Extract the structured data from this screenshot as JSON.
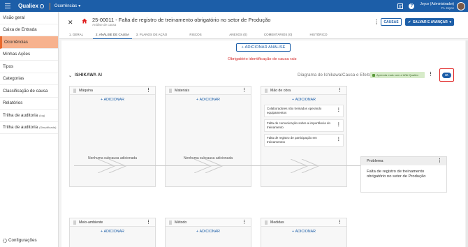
{
  "topbar": {
    "logo": "Qualiex",
    "module": "Ocorrências",
    "user_name": "Joyce (Administrador)",
    "user_sub": "FL Joyce"
  },
  "sidebar": {
    "items": [
      {
        "label": "Visão geral",
        "suffix": ""
      },
      {
        "label": "Caixa de Entrada",
        "suffix": ""
      },
      {
        "label": "Ocorrências",
        "suffix": ""
      },
      {
        "label": "Minhas Ações",
        "suffix": ""
      },
      {
        "label": "Tipos",
        "suffix": ""
      },
      {
        "label": "Categorias",
        "suffix": ""
      },
      {
        "label": "Classificação de causa",
        "suffix": ""
      },
      {
        "label": "Relatórios",
        "suffix": ""
      },
      {
        "label": "Trilha de auditoria",
        "suffix": "(log)"
      },
      {
        "label": "Trilha de auditoria",
        "suffix": "(Simplificada)"
      }
    ],
    "settings": "Configurações"
  },
  "header": {
    "title": "25-00011 - Falta de registro de treinamento obrigatório no setor de Produção",
    "subtitle": "Análise de causa",
    "causas_label": "CAUSAS",
    "save_label": "SALVAR E AVANÇAR",
    "tabs": [
      "1. GERAL",
      "2. ANÁLISE DE CAUSA",
      "3. PLANOS DE AÇÃO",
      "RISCOS",
      "ANEXOS (0)",
      "COMENTÁRIOS (0)",
      "HISTÓRICO"
    ]
  },
  "content": {
    "add_analysis": "ADICIONAR ANÁLISE",
    "required_msg": "Obrigatório identificação de causa raiz",
    "ishikawa_title": "ISHIKAWA AI",
    "diagram_label": "Diagrama de Ishikawa/Causa e Efeito",
    "wiki_label": "Aprenda mais com a Wiki Qualiex",
    "ia_label": "IA",
    "add_label": "ADICIONAR",
    "empty_label": "Nenhuma subcausa adicionada",
    "top_cards": [
      {
        "title": "Máquina"
      },
      {
        "title": "Materiais"
      },
      {
        "title": "Mão de obra",
        "items": [
          "Colaboradores não treinados operando equipamentos",
          "Falta de comunicação sobre a importância do treinamento",
          "Falta de registro de participação em treinamentos"
        ]
      }
    ],
    "bottom_cards": [
      {
        "title": "Meio-ambiente"
      },
      {
        "title": "Método"
      },
      {
        "title": "Medidas"
      }
    ],
    "problem_title": "Problema",
    "problem_text": "Falta de registro de treinamento obrigatório no setor de Produção"
  },
  "colors": {
    "brand": "#1c5ea8",
    "active_nav": "#f7b28e",
    "error": "#d52a2a"
  }
}
